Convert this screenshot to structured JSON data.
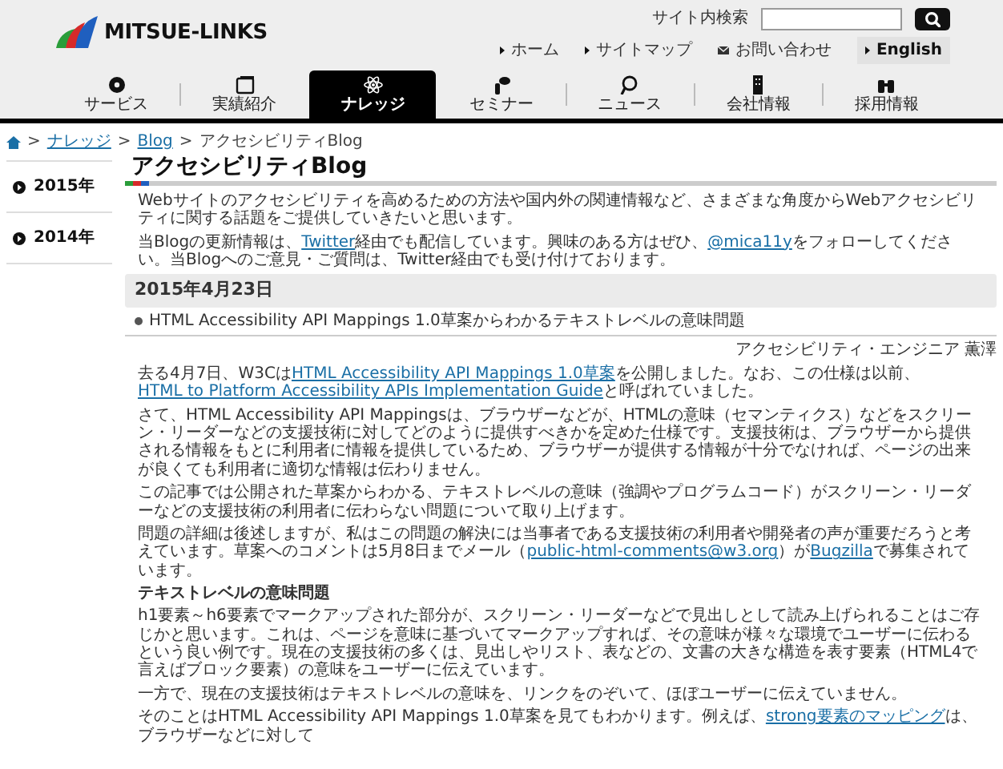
{
  "header": {
    "logo_text": "MITSUE-LINKS",
    "search": {
      "label": "サイト内検索"
    },
    "utility_links": [
      {
        "kind": "arrow",
        "label": "ホーム"
      },
      {
        "kind": "arrow",
        "label": "サイトマップ"
      },
      {
        "kind": "mail",
        "label": "お問い合わせ"
      },
      {
        "kind": "button",
        "label": "English"
      }
    ]
  },
  "nav": [
    {
      "label": "サービス",
      "selected": false
    },
    {
      "label": "実績紹介",
      "selected": false
    },
    {
      "label": "ナレッジ",
      "selected": true
    },
    {
      "label": "セミナー",
      "selected": false
    },
    {
      "label": "ニュース",
      "selected": false
    },
    {
      "label": "会社情報",
      "selected": false
    },
    {
      "label": "採用情報",
      "selected": false
    }
  ],
  "breadcrumb": [
    {
      "kind": "link",
      "label": "ナレッジ",
      "separator": ">"
    },
    {
      "kind": "link",
      "label": "Blog",
      "separator": ">"
    },
    {
      "kind": "current",
      "label": "アクセシビリティBlog",
      "separator": ">"
    }
  ],
  "sidebar": {
    "items": [
      {
        "label": "2015年"
      },
      {
        "label": "2014年"
      }
    ]
  },
  "page_title": "アクセシビリティBlog",
  "intro": [
    [
      {
        "kind": "text",
        "text": "Webサイトのアクセシビリティを高めるための方法や国内外の関連情報など、さまざまな角度からWebアクセシビリティに関する話題をご提供していきたいと思います。"
      }
    ],
    [
      {
        "kind": "text",
        "text": "当Blogの更新情報は、"
      },
      {
        "kind": "link",
        "text": "Twitter"
      },
      {
        "kind": "text",
        "text": "経由でも配信しています。興味のある方はぜひ、"
      },
      {
        "kind": "link",
        "text": "@mica11y"
      },
      {
        "kind": "text",
        "text": "をフォローしてください。当Blogへのご意見・ご質問は、Twitter経由でも受け付けております。"
      }
    ]
  ],
  "date_heading": "2015年4月23日",
  "article": {
    "title": "HTML Accessibility API Mappings 1.0草案からわかるテキストレベルの意味問題",
    "author": "アクセシビリティ・エンジニア 薫澤",
    "blocks": [
      {
        "kind": "p",
        "segments": [
          {
            "kind": "text",
            "text": "去る4月7日、W3Cは"
          },
          {
            "kind": "link",
            "text": "HTML Accessibility API Mappings 1.0草案"
          },
          {
            "kind": "text",
            "text": "を公開しました。なお、この仕様は以前、"
          },
          {
            "kind": "link",
            "text": "HTML to Platform Accessibility APIs Implementation Guide"
          },
          {
            "kind": "text",
            "text": "と呼ばれていました。"
          }
        ]
      },
      {
        "kind": "p",
        "segments": [
          {
            "kind": "text",
            "text": "さて、HTML Accessibility API Mappingsは、ブラウザーなどが、HTMLの意味（セマンティクス）などをスクリーン・リーダーなどの支援技術に対してどのように提供すべきかを定めた仕様です。支援技術は、ブラウザーから提供される情報をもとに利用者に情報を提供しているため、ブラウザーが提供する情報が十分でなければ、ページの出来が良くても利用者に適切な情報は伝わりません。"
          }
        ]
      },
      {
        "kind": "p",
        "segments": [
          {
            "kind": "text",
            "text": "この記事では公開された草案からわかる、テキストレベルの意味（強調やプログラムコード）がスクリーン・リーダーなどの支援技術の利用者に伝わらない問題について取り上げます。"
          }
        ]
      },
      {
        "kind": "p",
        "segments": [
          {
            "kind": "text",
            "text": "問題の詳細は後述しますが、私はこの問題の解決には当事者である支援技術の利用者や開発者の声が重要だろうと考えています。草案へのコメントは5月8日までメール（"
          },
          {
            "kind": "link",
            "text": "public-html-comments@w3.org"
          },
          {
            "kind": "text",
            "text": "）が"
          },
          {
            "kind": "link",
            "text": "Bugzilla"
          },
          {
            "kind": "text",
            "text": "で募集されています。"
          }
        ]
      },
      {
        "kind": "h",
        "text": "テキストレベルの意味問題"
      },
      {
        "kind": "p",
        "segments": [
          {
            "kind": "text",
            "text": "h1要素～h6要素でマークアップされた部分が、スクリーン・リーダーなどで見出しとして読み上げられることはご存じかと思います。これは、ページを意味に基づいてマークアップすれば、その意味が様々な環境でユーザーに伝わるという良い例です。現在の支援技術の多くは、見出しやリスト、表などの、文書の大きな構造を表す要素（HTML4で言えばブロック要素）の意味をユーザーに伝えています。"
          }
        ]
      },
      {
        "kind": "p",
        "segments": [
          {
            "kind": "text",
            "text": "一方で、現在の支援技術はテキストレベルの意味を、リンクをのぞいて、ほぼユーザーに伝えていません。"
          }
        ]
      },
      {
        "kind": "p",
        "segments": [
          {
            "kind": "text",
            "text": "そのことはHTML Accessibility API Mappings 1.0草案を見てもわかります。例えば、"
          },
          {
            "kind": "link",
            "text": "strong要素のマッピング"
          },
          {
            "kind": "text",
            "text": "は、ブラウザーなどに対して"
          }
        ]
      }
    ]
  }
}
